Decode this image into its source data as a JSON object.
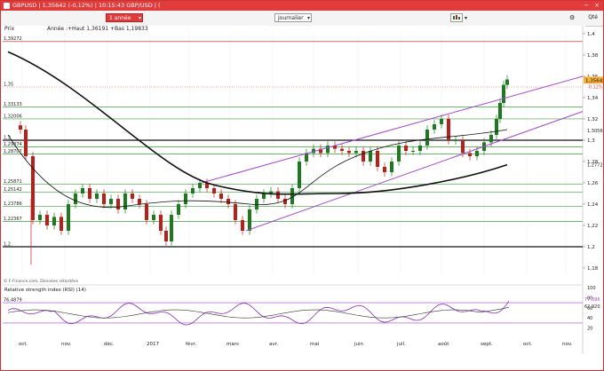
{
  "window": {
    "title": "GBPUSD | 1,35642 (-0,12%) | 10:15:43 GBP/USD | (",
    "close_label": "×",
    "min_label": "−"
  },
  "toolbar": {
    "period": "1 année",
    "interval": "Journalier",
    "qte_label": "Qté"
  },
  "chart_header": {
    "prix_label": "Prix",
    "stats": "Année :+Haut 1,36191 +Bas 1,19833",
    "source": "© F-Finance.com, Données retardées"
  },
  "rsi": {
    "title": "Relative strength index (RSI) (14)",
    "left_value": "76,4879",
    "right_value1": "77,396",
    "right_value2": "62,920"
  },
  "price_axis": {
    "ticks": [
      "1,4",
      "1,38",
      "1,36",
      "1,34",
      "1,32",
      "1,3",
      "1,28",
      "1,26",
      "1,24",
      "1,22",
      "1,2",
      "1,18"
    ],
    "current": "1,35642",
    "change": "-0,12%",
    "level_1_305": "1,30564",
    "level_1_277": "1,27727"
  },
  "rsi_axis": {
    "ticks": [
      "100",
      "80",
      "60",
      "40",
      "20"
    ]
  },
  "left_levels": [
    "1,39272",
    "1,35",
    "1,33133",
    "1,32006",
    "1,3",
    "1,29374",
    "1,28707",
    "1,25871",
    "1,25142",
    "1,23786",
    "1,22367",
    "1,2"
  ],
  "x_axis": [
    "oct.",
    "nov.",
    "déc.",
    "2017",
    "févr.",
    "mars",
    "avr.",
    "mai",
    "juin",
    "juil.",
    "août",
    "sept.",
    "oct.",
    "nov."
  ],
  "colors": {
    "accent": "#e23b3b",
    "candle_up": "#1e7a1e",
    "candle_down": "#b8201a",
    "channel": "#a347d1",
    "ma_fast": "#111111",
    "ma_slow": "#111111",
    "horiz_green": "#3aa33a",
    "dotted_red": "#e23b3b"
  }
}
